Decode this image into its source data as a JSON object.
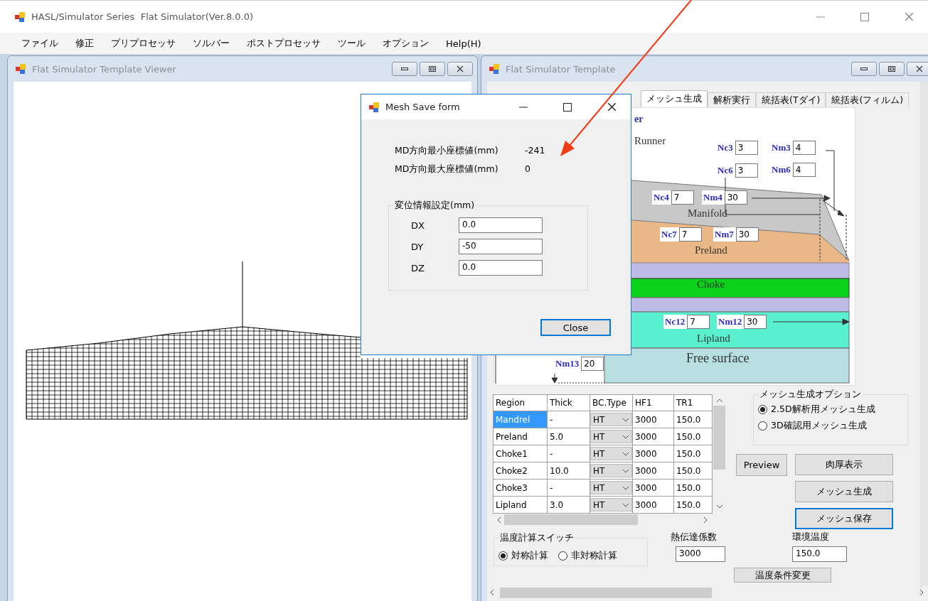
{
  "window": {
    "title": "HASL/Simulator Series  Flat Simulator(Ver.8.0.0)"
  },
  "menu": [
    "ファイル",
    "修正",
    "プリプロセッサ",
    "ソルバー",
    "ポストプロセッサ",
    "ツール",
    "オプション",
    "Help(H)"
  ],
  "viewer": {
    "title": "Flat Simulator Template Viewer"
  },
  "template": {
    "title": "Flat Simulator Template",
    "tabs": [
      {
        "label": "メッシュ生成",
        "selected": true
      },
      {
        "label": "解析実行",
        "selected": false
      },
      {
        "label": "統括表(Tダイ)",
        "selected": false
      },
      {
        "label": "統括表(フィルム)",
        "selected": false
      }
    ],
    "diagram": {
      "fragment": "er",
      "layer_labels": [
        "Runner",
        "Manifold",
        "Preland",
        "Choke",
        "Lipland",
        "Free surface"
      ],
      "parameters": [
        {
          "label": "Nc3",
          "value": "3"
        },
        {
          "label": "Nm3",
          "value": "4"
        },
        {
          "label": "Nc6",
          "value": "3"
        },
        {
          "label": "Nm6",
          "value": "4"
        },
        {
          "label": "Nc4",
          "value": "7"
        },
        {
          "label": "Nm4",
          "value": "30"
        },
        {
          "label": "Nc7",
          "value": "7"
        },
        {
          "label": "Nm7",
          "value": "30"
        },
        {
          "label": "Nc12",
          "value": "7"
        },
        {
          "label": "Nm12",
          "value": "30"
        },
        {
          "label": "Nm13",
          "value": "20"
        }
      ]
    },
    "table": {
      "columns": [
        "Region",
        "Thick",
        "BC.Type",
        "HF1",
        "TR1"
      ],
      "rows": [
        {
          "cells": [
            "Mandrel",
            "-",
            "HT",
            "3000",
            "150.0"
          ],
          "selected": true
        },
        {
          "cells": [
            "Preland",
            "5.0",
            "HT",
            "3000",
            "150.0"
          ],
          "selected": false
        },
        {
          "cells": [
            "Choke1",
            "-",
            "HT",
            "3000",
            "150.0"
          ],
          "selected": false
        },
        {
          "cells": [
            "Choke2",
            "10.0",
            "HT",
            "3000",
            "150.0"
          ],
          "selected": false
        },
        {
          "cells": [
            "Choke3",
            "-",
            "HT",
            "3000",
            "150.0"
          ],
          "selected": false
        },
        {
          "cells": [
            "Lipland",
            "3.0",
            "HT",
            "3000",
            "150.0"
          ],
          "selected": false
        }
      ]
    },
    "mesh_options": {
      "title": "メッシュ生成オプション",
      "options": [
        {
          "label": "2.5D解析用メッシュ生成",
          "selected": true
        },
        {
          "label": "3D確認用メッシュ生成",
          "selected": false
        }
      ]
    },
    "buttons": [
      {
        "label": "Preview",
        "focused": false
      },
      {
        "label": "肉厚表示",
        "focused": false
      },
      {
        "label": "メッシュ生成",
        "focused": false
      },
      {
        "label": "メッシュ保存",
        "focused": true
      }
    ],
    "temperature_switch": {
      "title": "温度計算スイッチ",
      "options": [
        {
          "label": "対称計算",
          "selected": true
        },
        {
          "label": "非対称計算",
          "selected": false
        }
      ]
    },
    "heat_transfer": {
      "label": "熱伝達係数",
      "value": "3000"
    },
    "ambient_temperature": {
      "label": "環境温度",
      "value": "150.0"
    },
    "temperature_button": "温度条件変更"
  },
  "dialog": {
    "title": "Mesh Save form",
    "readouts": [
      {
        "label": "MD方向最小座標値(mm)",
        "value": "-241"
      },
      {
        "label": "MD方向最大座標値(mm)",
        "value": "0"
      }
    ],
    "group": {
      "title": "変位情報設定(mm)",
      "fields": [
        {
          "label": "DX",
          "value": "0.0"
        },
        {
          "label": "DY",
          "value": "-50"
        },
        {
          "label": "DZ",
          "value": "0.0"
        }
      ]
    },
    "close": {
      "label": "Close",
      "focused": true
    }
  }
}
